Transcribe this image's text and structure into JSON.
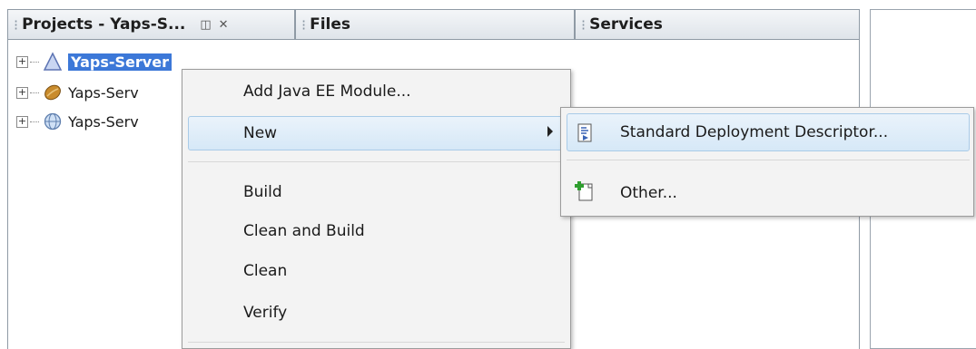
{
  "tabs": [
    {
      "label": "Projects - Yaps-S...",
      "restore_icon": "◫",
      "close_icon": "✕"
    },
    {
      "label": "Files"
    },
    {
      "label": "Services"
    }
  ],
  "tree": [
    {
      "label": "Yaps-Server",
      "icon": "triangle-project-icon",
      "selected": true
    },
    {
      "label": "Yaps-Serv",
      "icon": "bean-icon"
    },
    {
      "label": "Yaps-Serv",
      "icon": "globe-icon"
    }
  ],
  "context_menu": {
    "items": [
      {
        "label": "Add Java EE Module..."
      },
      {
        "label": "New",
        "has_submenu": true
      },
      {
        "label": "Build"
      },
      {
        "label": "Clean and Build"
      },
      {
        "label": "Clean"
      },
      {
        "label": "Verify"
      }
    ]
  },
  "submenu": {
    "items": [
      {
        "label": "Standard Deployment Descriptor...",
        "icon": "deployment-descriptor-icon"
      },
      {
        "label": "Other...",
        "icon": "new-file-icon"
      }
    ]
  },
  "colors": {
    "selection": "#3c78d8",
    "menu_highlight": "#d6e8f7",
    "menu_background": "#f3f3f3"
  }
}
